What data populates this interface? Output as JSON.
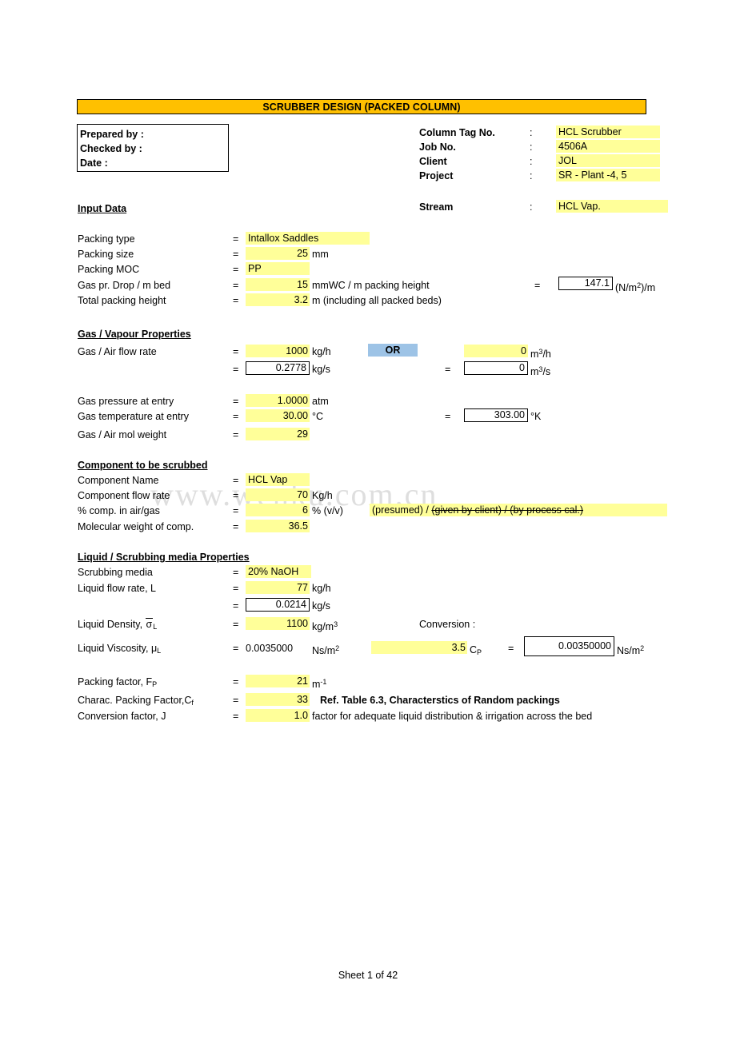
{
  "document": {
    "title": "SCRUBBER DESIGN (PACKED COLUMN)",
    "footer": "Sheet 1 of 42",
    "watermark": "www.wenku.com.cn"
  },
  "prepared_box": {
    "prepared_by": "Prepared by :",
    "checked_by": "Checked by :",
    "date": "Date :"
  },
  "header_info": {
    "labels": {
      "column_tag": "Column Tag No.",
      "job_no": "Job No.",
      "client": "Client",
      "project": "Project",
      "stream": "Stream"
    },
    "colon": ":",
    "values": {
      "column_tag": "HCL Scrubber",
      "job_no": "4506A",
      "client": "JOL",
      "project": "SR - Plant -4, 5",
      "stream": "HCL Vap."
    }
  },
  "sections": {
    "input_data": "Input Data",
    "gas_vapour": "Gas / Vapour Properties",
    "component": "Component to be scrubbed",
    "liquid": "Liquid / Scrubbing media Properties"
  },
  "input_data": {
    "rows": [
      {
        "label": "Packing type",
        "eq": "=",
        "value": "Intallox Saddles",
        "unit": ""
      },
      {
        "label": "Packing size",
        "eq": "=",
        "value": "25",
        "unit": "mm"
      },
      {
        "label": "Packing MOC",
        "eq": "=",
        "value": "PP",
        "unit": ""
      },
      {
        "label": "Gas pr. Drop / m bed",
        "eq": "=",
        "value": "15",
        "unit": "mmWC / m packing height"
      },
      {
        "label": "Total packing height",
        "eq": "=",
        "value": "3.2",
        "unit": "m (including all packed beds)"
      }
    ],
    "pr_drop_conv": {
      "eq": "=",
      "value": "147.1",
      "unit_pre": "(N/m",
      "unit_sup": "2",
      "unit_post": ")/m"
    }
  },
  "gas": {
    "flow_rate_label": "Gas / Air flow rate",
    "flow_kgh": "1000",
    "flow_kgh_unit": "kg/h",
    "or_label": "OR",
    "flow_m3h": "0",
    "flow_m3h_unit_pre": "m",
    "flow_m3h_unit_sup": "3",
    "flow_m3h_unit_post": "/h",
    "flow_kgs": "0.2778",
    "flow_kgs_unit": "kg/s",
    "flow_m3s": "0",
    "flow_m3s_unit_pre": "m",
    "flow_m3s_unit_sup": "3",
    "flow_m3s_unit_post": "/s",
    "pressure_label": "Gas pressure at entry",
    "pressure_value": "1.0000",
    "pressure_unit": "atm",
    "temp_label": "Gas temperature at entry",
    "temp_value": "30.00",
    "temp_unit": "°C",
    "temp_k_value": "303.00",
    "temp_k_unit": "°K",
    "mol_weight_label": "Gas / Air mol weight",
    "mol_weight_value": "29",
    "eq": "="
  },
  "component": {
    "name_label": "Component Name",
    "name_value": "HCL Vap",
    "flow_label": "Component flow rate",
    "flow_value": "70",
    "flow_unit": "Kg/h",
    "pct_label": "% comp. in air/gas",
    "pct_value": "6",
    "pct_unit": "% (v/v)",
    "pct_note_1": "(presumed) /",
    "pct_note_2": "(given by client) / (by process cal.)",
    "mw_label": "Molecular weight of comp.",
    "mw_value": "36.5",
    "eq": "="
  },
  "liquid": {
    "media_label": "Scrubbing media",
    "media_value": "20% NaOH",
    "flow_label": "Liquid flow rate, L",
    "flow_kgh": "77",
    "flow_kgh_unit": "kg/h",
    "flow_kgs": "0.0214",
    "flow_kgs_unit": "kg/s",
    "density_label_pre": "Liquid Density, ",
    "density_label_sym": "σ",
    "density_label_sub": "L",
    "density_value": "1100",
    "density_unit_pre": "kg/m",
    "density_unit_sup": "3",
    "viscosity_label_pre": "Liquid Viscosity, μ",
    "viscosity_label_sub": "L",
    "viscosity_value": "0.0035000",
    "viscosity_unit_pre": "Ns/m",
    "viscosity_unit_sup": "2",
    "conversion_label": "Conversion :",
    "cp_value": "3.5",
    "cp_unit_pre": "C",
    "cp_unit_sub": "P",
    "cp_converted": "0.00350000",
    "cp_converted_unit_pre": "Ns/m",
    "cp_converted_unit_sup": "2",
    "eq": "="
  },
  "packing_factors": {
    "fp_label_pre": "Packing factor, F",
    "fp_label_sub": "P",
    "fp_value": "21",
    "fp_unit_pre": "m",
    "fp_unit_sup": "-1",
    "cf_label_pre": "Charac. Packing Factor,C",
    "cf_label_sub": "f",
    "cf_value": "33",
    "cf_note": "Ref. Table 6.3, Characterstics of Random packings",
    "j_label": "Conversion factor, J",
    "j_value": "1.0",
    "j_note": "factor for adequate liquid distribution & irrigation across the bed",
    "eq": "="
  }
}
